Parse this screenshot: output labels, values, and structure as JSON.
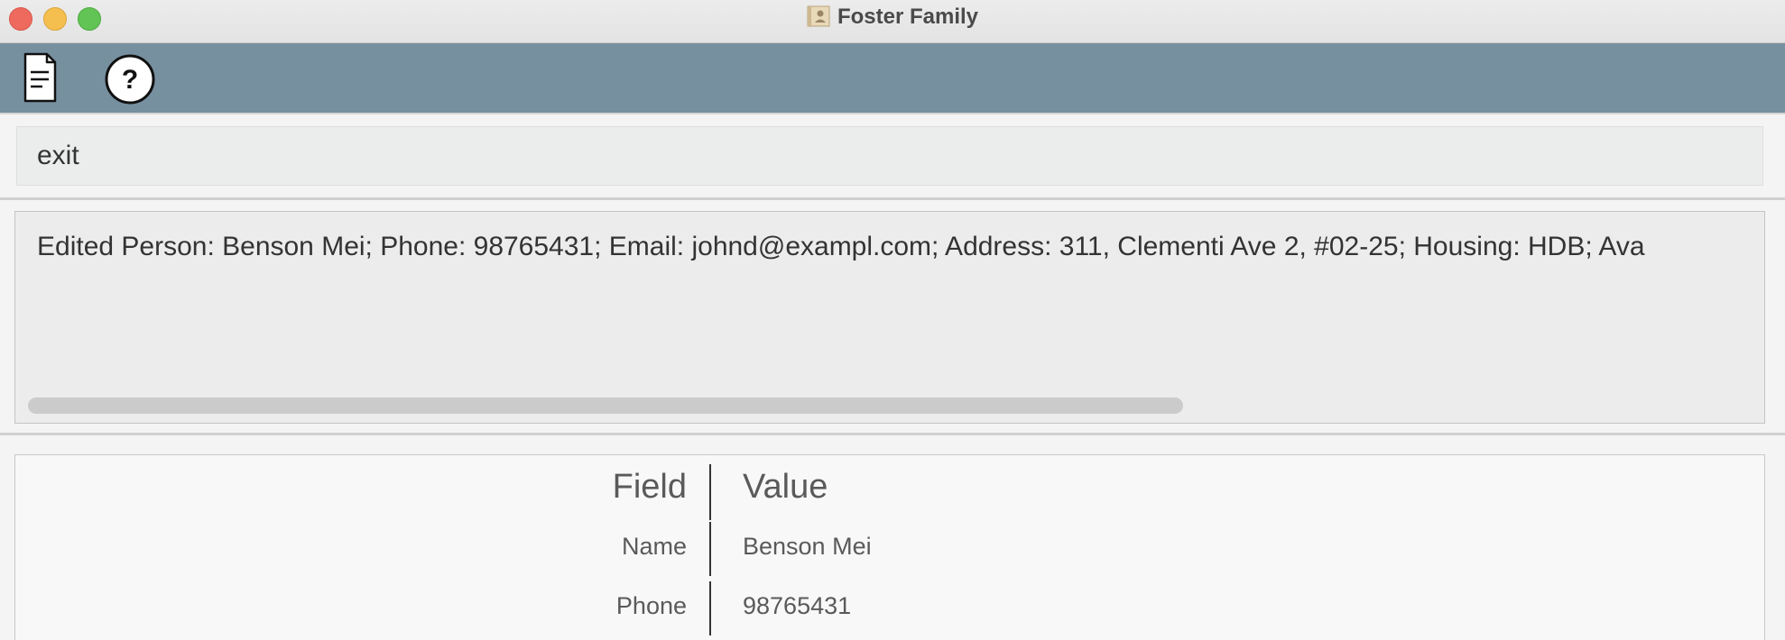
{
  "window": {
    "title": "Foster Family"
  },
  "toolbar": {
    "icons": [
      "file-icon",
      "help-icon"
    ]
  },
  "command_box": {
    "value": "exit"
  },
  "result_display": {
    "text": "Edited Person: Benson Mei; Phone: 98765431; Email: johnd@exampl.com; Address: 311, Clementi Ave 2, #02-25; Housing: HDB; Ava"
  },
  "detail_table": {
    "headers": {
      "field": "Field",
      "value": "Value"
    },
    "rows": [
      {
        "field": "Name",
        "value": "Benson Mei"
      },
      {
        "field": "Phone",
        "value": "98765431"
      }
    ]
  },
  "colors": {
    "toolbar_bg": "#7790a0",
    "close": "#ee6a5f",
    "minimize": "#f5bf4f",
    "zoom": "#61c454"
  }
}
